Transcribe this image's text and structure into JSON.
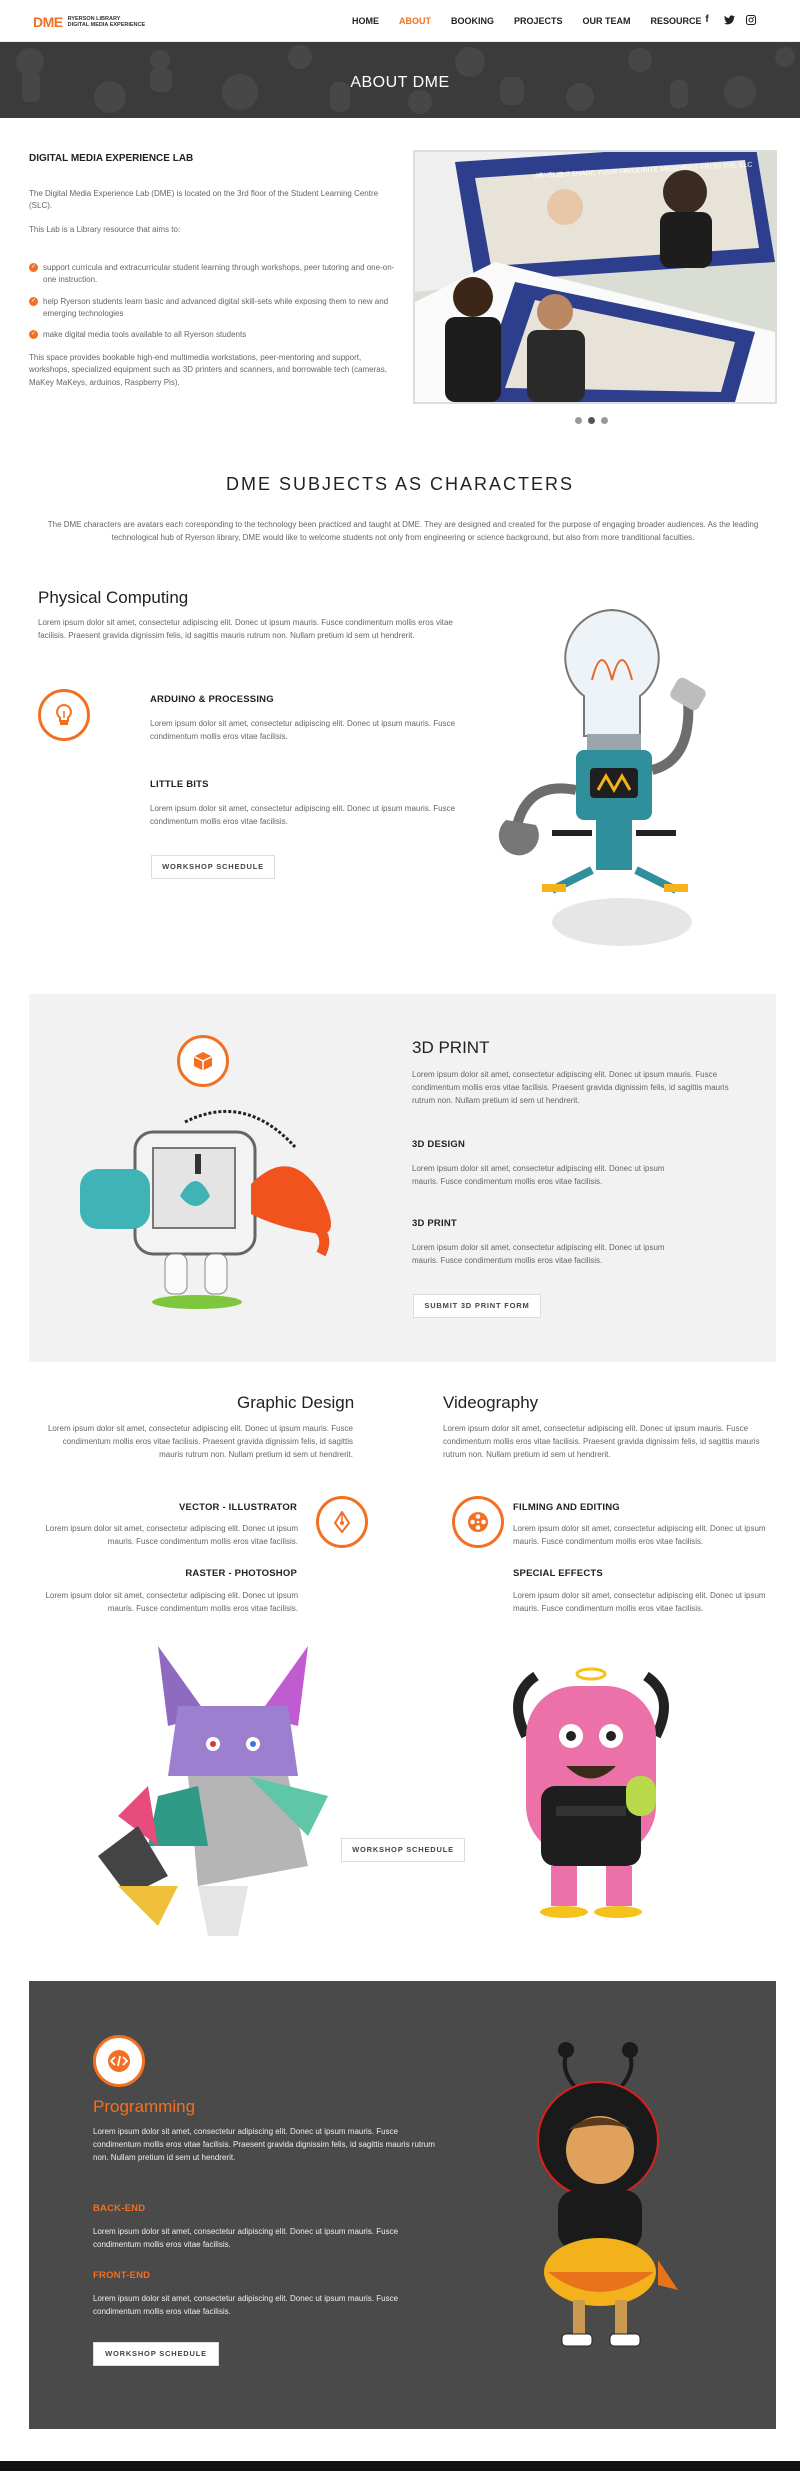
{
  "nav": {
    "logo_mark": "DME",
    "logo_line1": "RYERSON LIBRARY",
    "logo_line2": "DIGITAL MEDIA EXPERIENCE",
    "items": [
      {
        "label": "HOME"
      },
      {
        "label": "ABOUT"
      },
      {
        "label": "BOOKING"
      },
      {
        "label": "PROJECTS"
      },
      {
        "label": "OUR TEAM"
      },
      {
        "label": "RESOURCE"
      }
    ],
    "active": "ABOUT",
    "social": [
      "facebook-icon",
      "twitter-icon",
      "instagram-icon"
    ],
    "social_glyphs": [
      "f",
      "t",
      "◎"
    ]
  },
  "hero": {
    "title": "ABOUT DME"
  },
  "about": {
    "heading": "DIGITAL MEDIA EXPERIENCE LAB",
    "p1": "The Digital Media Experience Lab (DME) is located on the 3rd floor of the Student Learning Centre (SLC).",
    "p2": "This Lab is a Library resource that aims to:",
    "bullets": [
      "support curricula and extracurricular student learning through workshops, peer tutoring and one-on-one instruction.",
      "help Ryerson students learn basic and advanced digital skill-sets while exposing them to new and emerging technologies",
      "make digital media tools available to all Ryerson students"
    ],
    "p3": "This space provides bookable high-end multimedia workstations, peer-mentoring and support, workshops, specialized equipment such as 3D printers and scanners, and borrowable tech (cameras, MaKey MaKeys, arduinos, Raspberry Pis).",
    "slider_caption": "#RYELIB // SHARE YOUR FAVOURITE MEMORIES FROM THE SLC",
    "slide_count": 3,
    "active_slide": 2
  },
  "subjects": {
    "title": "DME SUBJECTS AS CHARACTERS",
    "description": "The DME characters are avatars each coresponding to the technology been practiced and taught at DME. They are designed and created for the purpose of engaging broader audiences. As the leading technological hub of Ryerson library, DME would like to welcome students not only from engineering or science background, but also from more tranditional faculties."
  },
  "physical": {
    "title": "Physical Computing",
    "intro": "Lorem ipsum dolor sit amet, consectetur adipiscing elit. Donec ut ipsum mauris. Fusce condimentum mollis eros vitae facilisis. Praesent gravida dignissim felis, id sagittis mauris rutrum non. Nullam pretium id sem ut hendrerit.",
    "sub1": "ARDUINO & PROCESSING",
    "sub1_text": "Lorem ipsum dolor sit amet, consectetur adipiscing elit. Donec ut ipsum mauris. Fusce condimentum mollis eros vitae facilisis.",
    "sub2": "LITTLE BITS",
    "sub2_text": "Lorem ipsum dolor sit amet, consectetur adipiscing elit. Donec ut ipsum mauris. Fusce condimentum mollis eros vitae facilisis.",
    "button": "WORKSHOP SCHEDULE"
  },
  "print3d": {
    "title": "3D PRINT",
    "intro": "Lorem ipsum dolor sit amet, consectetur adipiscing elit. Donec ut ipsum mauris. Fusce condimentum mollis eros vitae facilisis. Praesent gravida dignissim felis, id sagittis mauris rutrum non. Nullam pretium id sem ut hendrerit.",
    "sub1": "3D DESIGN",
    "sub1_text": "Lorem ipsum dolor sit amet, consectetur adipiscing elit. Donec ut ipsum mauris. Fusce condimentum mollis eros vitae facilisis.",
    "sub2": "3D PRINT",
    "sub2_text": "Lorem ipsum dolor sit amet, consectetur adipiscing elit. Donec ut ipsum mauris. Fusce condimentum mollis eros vitae facilisis.",
    "button": "SUBMIT 3D PRINT FORM"
  },
  "graphic": {
    "title": "Graphic Design",
    "intro": "Lorem ipsum dolor sit amet, consectetur adipiscing elit. Donec ut ipsum mauris. Fusce condimentum mollis eros vitae facilisis. Praesent gravida dignissim felis, id sagittis mauris rutrum non. Nullam pretium id sem ut hendrerit.",
    "sub1": "VECTOR - ILLUSTRATOR",
    "sub1_text": "Lorem ipsum dolor sit amet, consectetur adipiscing elit. Donec ut ipsum mauris. Fusce condimentum mollis eros vitae facilisis.",
    "sub2": "RASTER - PHOTOSHOP",
    "sub2_text": "Lorem ipsum dolor sit amet, consectetur adipiscing elit. Donec ut ipsum mauris. Fusce condimentum mollis eros vitae facilisis."
  },
  "video": {
    "title": "Videography",
    "intro": "Lorem ipsum dolor sit amet, consectetur adipiscing elit. Donec ut ipsum mauris. Fusce condimentum mollis eros vitae facilisis. Praesent gravida dignissim felis, id sagittis mauris rutrum non. Nullam pretium id sem ut hendrerit.",
    "sub1": "FILMING AND EDITING",
    "sub1_text": "Lorem ipsum dolor sit amet, consectetur adipiscing elit. Donec ut ipsum mauris. Fusce condimentum mollis eros vitae facilisis.",
    "sub2": "SPECIAL EFFECTS",
    "sub2_text": "Lorem ipsum dolor sit amet, consectetur adipiscing elit. Donec ut ipsum mauris. Fusce condimentum mollis eros vitae facilisis."
  },
  "media_button": "WORKSHOP SCHEDULE",
  "programming": {
    "title": "Programming",
    "intro": "Lorem ipsum dolor sit amet, consectetur adipiscing elit. Donec ut ipsum mauris. Fusce condimentum mollis eros vitae facilisis. Praesent gravida dignissim felis, id sagittis mauris rutrum non. Nullam pretium id sem ut hendrerit.",
    "sub1": "BACK-END",
    "sub1_text": "Lorem ipsum dolor sit amet, consectetur adipiscing elit. Donec ut ipsum mauris. Fusce condimentum mollis eros vitae facilisis.",
    "sub2": "FRONT-END",
    "sub2_text": "Lorem ipsum dolor sit amet, consectetur adipiscing elit. Donec ut ipsum mauris. Fusce condimentum mollis eros vitae facilisis.",
    "button": "WORKSHOP SCHEDULE"
  },
  "colors": {
    "accent": "#f36f21",
    "hero_bg": "#3b3b3b",
    "panel_light": "#f2f2f2",
    "panel_dark": "#4a4a4a"
  }
}
